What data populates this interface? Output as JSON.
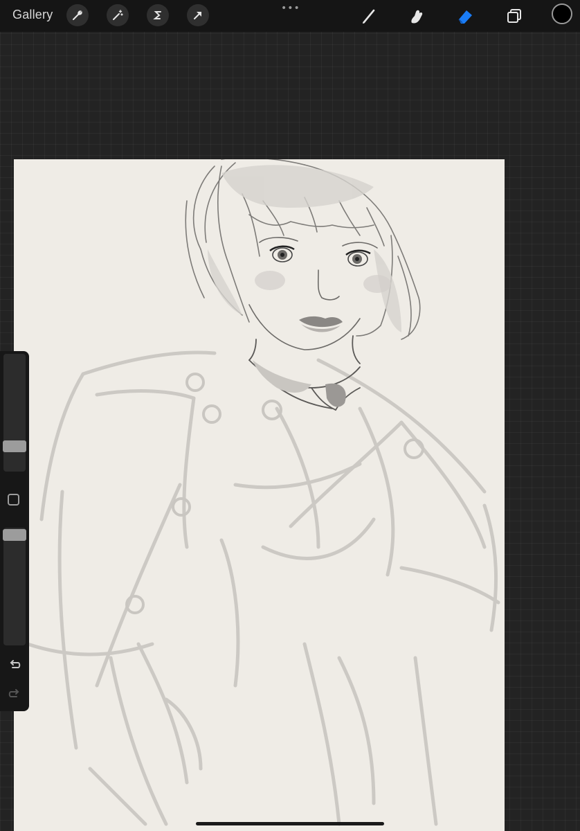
{
  "topbar": {
    "gallery_label": "Gallery",
    "more_dots": "•••",
    "left_tools": [
      {
        "name": "actions",
        "icon": "wrench-icon"
      },
      {
        "name": "adjustments",
        "icon": "magic-wand-icon"
      },
      {
        "name": "selection",
        "icon": "selection-s-icon"
      },
      {
        "name": "transform",
        "icon": "arrow-cursor-icon"
      }
    ],
    "right_tools": [
      {
        "name": "brush",
        "icon": "brush-icon"
      },
      {
        "name": "smudge",
        "icon": "smudge-icon"
      },
      {
        "name": "eraser",
        "icon": "eraser-icon",
        "active": true,
        "active_color": "#1a7cf5"
      },
      {
        "name": "layers",
        "icon": "layers-icon"
      }
    ],
    "current_color": "#000000"
  },
  "sidebar": {
    "brush_size_level": 0.18,
    "opacity_level": 1.0,
    "modify_button_icon": "square-icon",
    "undo_icon": "undo-icon",
    "redo_icon": "redo-icon"
  },
  "canvas": {
    "paper_color": "#efece6",
    "artwork": "pencil-sketch-icon"
  }
}
